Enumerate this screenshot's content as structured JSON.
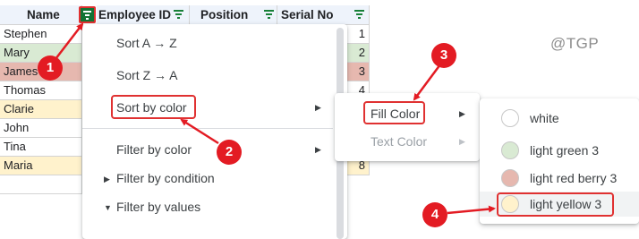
{
  "sheet": {
    "headers": [
      "Name",
      "Employee ID",
      "Position",
      "Serial No"
    ],
    "rows": [
      {
        "name": "Stephen",
        "serial": "1",
        "fill": "#ffffff"
      },
      {
        "name": "Mary",
        "serial": "2",
        "fill": "#d9ead3"
      },
      {
        "name": "James",
        "serial": "3",
        "fill": "#e6b8af"
      },
      {
        "name": "Thomas",
        "serial": "4",
        "fill": "#ffffff"
      },
      {
        "name": "Clarie",
        "serial": "",
        "fill": "#fff2cc"
      },
      {
        "name": "John",
        "serial": "",
        "fill": "#ffffff"
      },
      {
        "name": "Tina",
        "serial": "",
        "fill": "#ffffff"
      },
      {
        "name": "Maria",
        "serial": "8",
        "fill": "#fff2cc"
      }
    ]
  },
  "watermark": "@TGP",
  "filter_menu": {
    "items": [
      {
        "label": "Sort A → Z"
      },
      {
        "label": "Sort Z → A"
      },
      {
        "label": "Sort by color"
      },
      {
        "label": "Filter by color"
      },
      {
        "label": "Filter by condition"
      },
      {
        "label": "Filter by values"
      }
    ]
  },
  "sort_by_color_submenu": {
    "items": [
      {
        "label": "Fill Color",
        "enabled": true
      },
      {
        "label": "Text Color",
        "enabled": false
      }
    ]
  },
  "fill_color_options": [
    {
      "label": "white",
      "color": "#ffffff"
    },
    {
      "label": "light green 3",
      "color": "#d9ead3"
    },
    {
      "label": "light red berry 3",
      "color": "#e6b8af"
    },
    {
      "label": "light yellow 3",
      "color": "#fff2cc"
    }
  ],
  "callouts": [
    "1",
    "2",
    "3",
    "4"
  ],
  "colors": {
    "callout_red": "#e31b23",
    "filter_green": "#137333",
    "header_bg": "#eef3fb"
  }
}
